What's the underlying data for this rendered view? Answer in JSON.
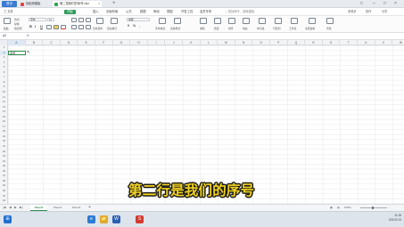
{
  "tabs": {
    "home": "首页",
    "doc_a": "找稻壳模板",
    "doc_b": "第二是我们的序号.xlsx",
    "close_glyph": "×",
    "new_tab": "+",
    "window_controls": [
      "□",
      "–",
      "□",
      "×"
    ]
  },
  "menu": {
    "items": [
      "三 文件",
      "开始",
      "插入",
      "页面布局",
      "公式",
      "数据",
      "审阅",
      "视图",
      "开发工具",
      "会员专享"
    ],
    "active_index": 1,
    "search": "查找命令、搜索模板",
    "right": [
      "未同步",
      "协作",
      "分享"
    ]
  },
  "toolbar": {
    "paste": "粘贴",
    "cut": "剪切",
    "copy": "复制",
    "format_painter": "格式刷",
    "font_name": "宋体",
    "font_size": "11",
    "bold": "B",
    "italic": "I",
    "underline": "U",
    "merge_center": "合并居中",
    "wrap": "自动换行",
    "number_format": "常规",
    "conditional": "条件格式",
    "table_style": "表格样式",
    "sum": "求和",
    "filter": "筛选",
    "sort": "排序",
    "fill": "填充",
    "cell": "单元格",
    "row_col": "行和列",
    "worksheet": "工作表",
    "freeze": "冻结窗格",
    "find": "查找"
  },
  "formula_bar": {
    "cell_ref": "A2",
    "fx": "fx"
  },
  "columns": [
    "A",
    "B",
    "C",
    "D",
    "E",
    "F",
    "G",
    "H",
    "I",
    "J",
    "K",
    "L",
    "M",
    "N",
    "O",
    "P",
    "Q",
    "R",
    "S",
    "T",
    "U",
    "V",
    "W"
  ],
  "selected_column": "A",
  "rows": [
    "1",
    "2",
    "3",
    "4",
    "5",
    "6",
    "7",
    "8",
    "9",
    "10",
    "11",
    "12",
    "13",
    "14",
    "15",
    "16",
    "17",
    "18",
    "19",
    "20",
    "21",
    "22",
    "23",
    "24",
    "25",
    "26",
    "27",
    "28",
    "29",
    "30",
    "31",
    "32"
  ],
  "selected_row": "2",
  "active_cell_text": "序号",
  "caption": "第二行是我们的序号",
  "sheets": [
    "Sheet1",
    "Sheet2",
    "Sheet3"
  ],
  "active_sheet": "Sheet1",
  "sheet_nav": [
    "|◀",
    "◀",
    "▶",
    "▶|"
  ],
  "add_sheet": "+",
  "zoom": "100%",
  "taskbar": {
    "apps": [
      "⊞",
      "e",
      "📁",
      "W",
      "S"
    ],
    "time": "11:28",
    "date": "2022/1/13"
  },
  "colors": {
    "accent_green": "#2f8d4e",
    "home_tab_blue": "#3b7cd6",
    "caption_yellow": "#f2d21f"
  }
}
